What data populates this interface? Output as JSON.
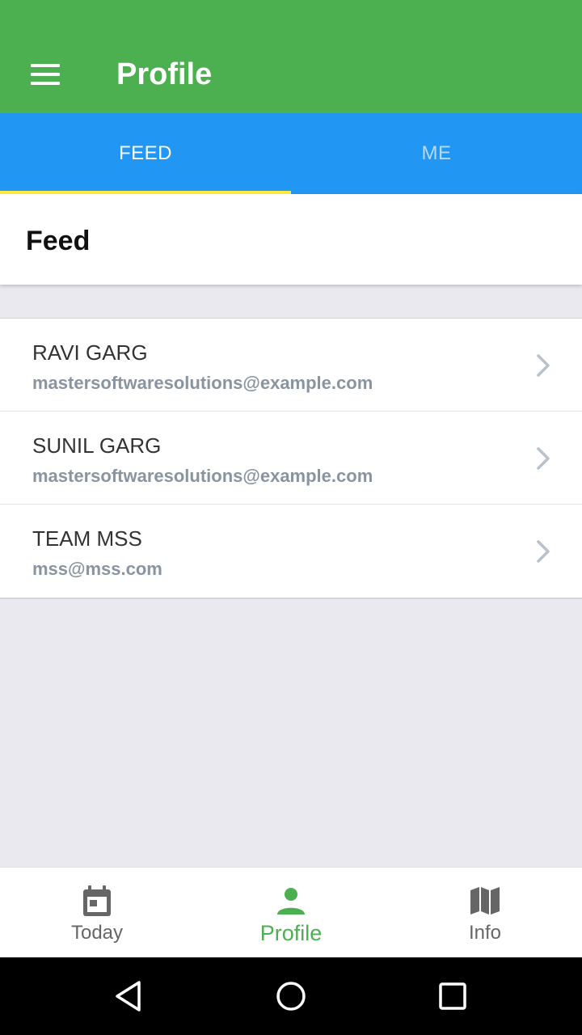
{
  "app_bar": {
    "title": "Profile",
    "menu_icon": "hamburger-menu-icon",
    "color": "#4caf50"
  },
  "tabs": [
    {
      "label": "FEED",
      "active": true
    },
    {
      "label": "ME",
      "active": false
    }
  ],
  "tab_colors": {
    "background": "#2196f3",
    "indicator": "#ffeb3b"
  },
  "section": {
    "title": "Feed"
  },
  "contacts": [
    {
      "name": "RAVI GARG",
      "email": "mastersoftwaresolutions@example.com"
    },
    {
      "name": "SUNIL GARG",
      "email": "mastersoftwaresolutions@example.com"
    },
    {
      "name": "TEAM MSS",
      "email": "mss@mss.com"
    }
  ],
  "bottom_nav": [
    {
      "label": "Today",
      "icon": "calendar-icon",
      "active": false
    },
    {
      "label": "Profile",
      "icon": "person-icon",
      "active": true
    },
    {
      "label": "Info",
      "icon": "map-icon",
      "active": false
    }
  ],
  "system_nav": [
    "back-icon",
    "home-icon",
    "recents-icon"
  ]
}
